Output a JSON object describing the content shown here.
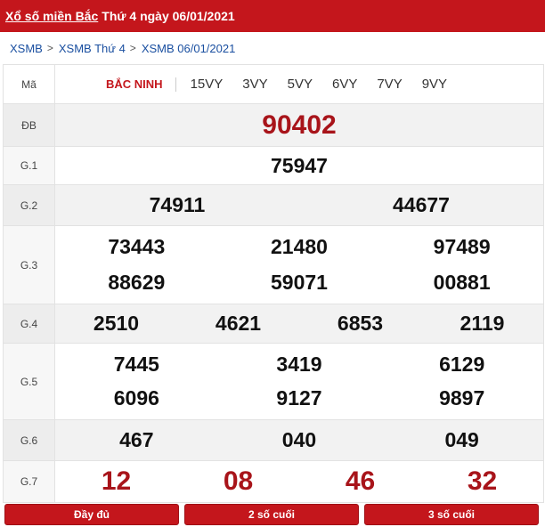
{
  "header": {
    "link": "Xổ số miền Bắc",
    "rest": "Thứ 4 ngày 06/01/2021"
  },
  "breadcrumb": [
    "XSMB",
    "XSMB Thứ 4",
    "XSMB 06/01/2021"
  ],
  "table": {
    "ma_label": "Mã",
    "province": "BẮC NINH",
    "codes": [
      "15VY",
      "3VY",
      "5VY",
      "6VY",
      "7VY",
      "9VY"
    ],
    "rows": [
      {
        "label": "ĐB",
        "numbers": [
          "90402"
        ]
      },
      {
        "label": "G.1",
        "numbers": [
          "75947"
        ]
      },
      {
        "label": "G.2",
        "numbers": [
          "74911",
          "44677"
        ]
      },
      {
        "label": "G.3",
        "numbers": [
          "73443",
          "21480",
          "97489",
          "88629",
          "59071",
          "00881"
        ]
      },
      {
        "label": "G.4",
        "numbers": [
          "2510",
          "4621",
          "6853",
          "2119"
        ]
      },
      {
        "label": "G.5",
        "numbers": [
          "7445",
          "3419",
          "6129",
          "6096",
          "9127",
          "9897"
        ]
      },
      {
        "label": "G.6",
        "numbers": [
          "467",
          "040",
          "049"
        ]
      },
      {
        "label": "G.7",
        "numbers": [
          "12",
          "08",
          "46",
          "32"
        ]
      }
    ]
  },
  "footer": [
    "Đầy đủ",
    "2 số cuối",
    "3 số cuối"
  ],
  "colors": {
    "brand_red": "#c4161c",
    "prize_red": "#a8141a"
  }
}
